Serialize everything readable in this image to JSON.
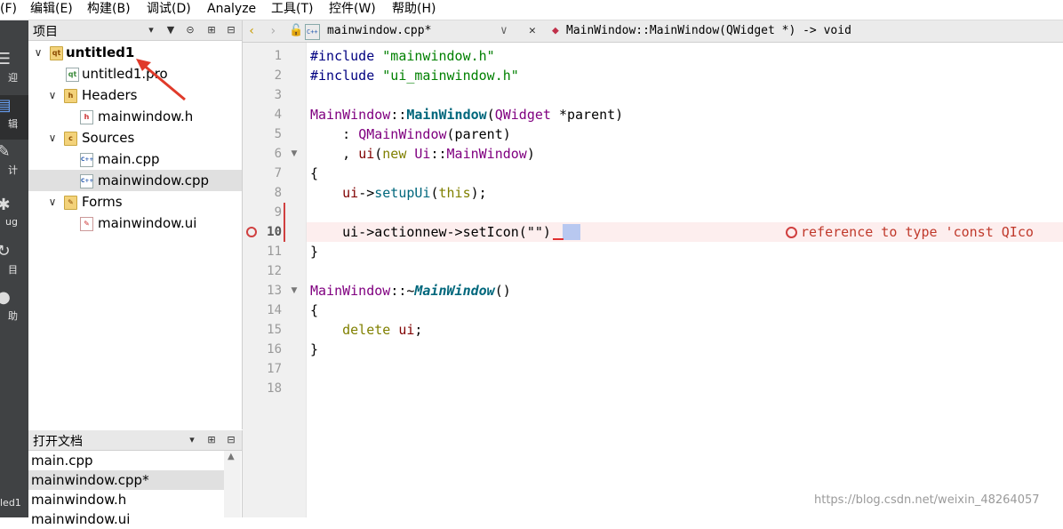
{
  "menubar": {
    "items": [
      "(F)",
      "编辑(E)",
      "构建(B)",
      "调试(D)",
      "Analyze",
      "工具(T)",
      "控件(W)",
      "帮助(H)"
    ]
  },
  "modebar": {
    "items": [
      {
        "label": "迎",
        "icon": "welcome-icon"
      },
      {
        "label": "辑",
        "icon": "edit-icon"
      },
      {
        "label": "计",
        "icon": "design-icon"
      },
      {
        "label": "ug",
        "icon": "debug-icon"
      },
      {
        "label": "目",
        "icon": "projects-icon"
      },
      {
        "label": "助",
        "icon": "help-icon"
      }
    ],
    "bottom_label": "led1"
  },
  "project_pane": {
    "title": "项目",
    "tree": {
      "project": "untitled1",
      "pro_file": "untitled1.pro",
      "headers": "Headers",
      "header_file": "mainwindow.h",
      "sources": "Sources",
      "source_files": [
        "main.cpp",
        "mainwindow.cpp"
      ],
      "forms": "Forms",
      "form_file": "mainwindow.ui"
    }
  },
  "open_docs": {
    "title": "打开文档",
    "items": [
      "main.cpp",
      "mainwindow.cpp*",
      "mainwindow.h",
      "mainwindow.ui"
    ]
  },
  "editor_toolbar": {
    "file": "mainwindow.cpp*",
    "symbol": "MainWindow::MainWindow(QWidget *) -> void",
    "file_badge": "C++"
  },
  "editor": {
    "line_numbers": [
      "1",
      "2",
      "3",
      "4",
      "5",
      "6",
      "7",
      "8",
      "9",
      "10",
      "11",
      "12",
      "13",
      "14",
      "15",
      "16",
      "17",
      "18"
    ],
    "current_line": "10",
    "error_message": "reference to type 'const QIco",
    "code": {
      "l1_pre": "#include",
      "l1_str": "\"mainwindow.h\"",
      "l2_pre": "#include",
      "l2_str": "\"ui_mainwindow.h\"",
      "l4_type": "MainWindow",
      "l4_sep": "::",
      "l4_func": "MainWindow",
      "l4_open": "(",
      "l4_ptype": "QWidget",
      "l4_rest": " *parent)",
      "l5_colon": "    : ",
      "l5_type": "QMainWindow",
      "l5_rest": "(parent)",
      "l6_comma": "    , ",
      "l6_member": "ui",
      "l6_open": "(",
      "l6_new": "new",
      "l6_sp": " ",
      "l6_ns": "Ui",
      "l6_sep": "::",
      "l6_cls": "MainWindow",
      "l6_close": ")",
      "l7": "{",
      "l8_indent": "    ",
      "l8_member": "ui",
      "l8_arrow": "->",
      "l8_call": "setupUi",
      "l8_open": "(",
      "l8_this": "this",
      "l8_close": ");",
      "l10_text": "    ui->actionnew->setIcon(\"\")",
      "l11": "}",
      "l13_type": "MainWindow",
      "l13_sep": "::~",
      "l13_func": "MainWindow",
      "l13_rest": "()",
      "l14": "{",
      "l15_indent": "    ",
      "l15_kw": "delete",
      "l15_sp": " ",
      "l15_member": "ui",
      "l15_end": ";",
      "l16": "}"
    }
  },
  "watermark": "https://blog.csdn.net/weixin_48264057",
  "colors": {
    "error": "#d04040",
    "selection": "#e0e0e0",
    "modebar": "#404244"
  }
}
